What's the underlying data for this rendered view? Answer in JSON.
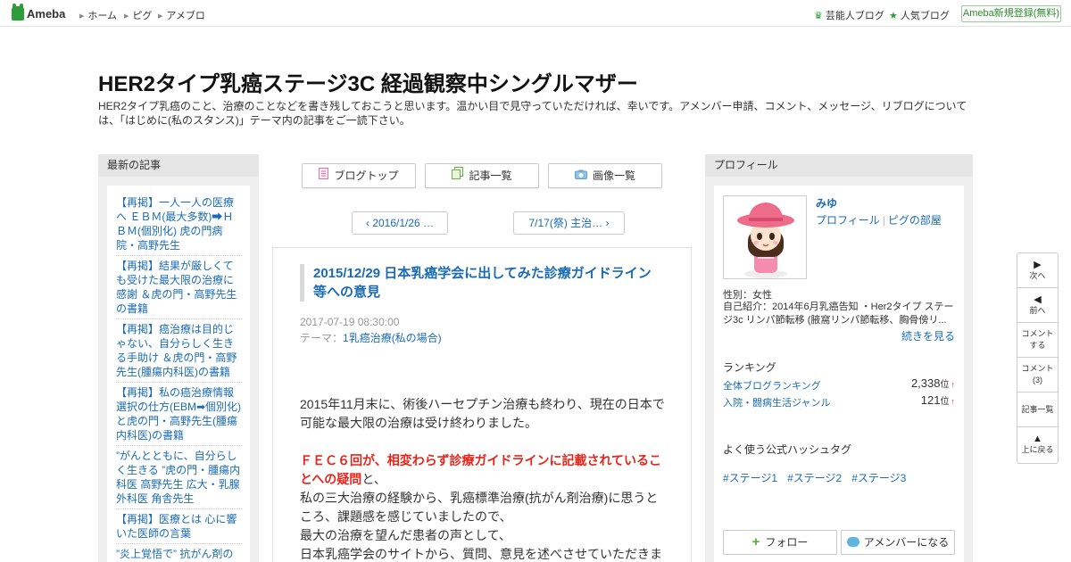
{
  "topbar": {
    "logo": "Ameba",
    "nav": [
      "ホーム",
      "ピグ",
      "アメブロ"
    ],
    "celeb_blog": "芸能人ブログ",
    "popular_blog": "人気ブログ",
    "signup": "Ameba新規登録(無料)"
  },
  "blog": {
    "title": "HER2タイプ乳癌ステージ3C 経過観察中シングルマザー",
    "description": "HER2タイプ乳癌のこと、治療のことなどを書き残しておこうと思います。温かい目で見守っていただければ、幸いです。アメンバー申請、コメント、メッセージ、リブログについては、「はじめに(私のスタンス)」テーマ内の記事をご一読下さい。"
  },
  "recent": {
    "heading": "最新の記事",
    "items": [
      "【再掲】一人一人の医療へ ＥＢＭ(最大多数)➡ＨＢＭ(個別化) 虎の門病院・高野先生",
      "【再掲】結果が厳しくても受けた最大限の治療に感謝 ＆虎の門・高野先生の書籍",
      "【再掲】癌治療は目的じゃない、自分らしく生きる手助け ＆虎の門・高野先生(腫瘍内科医)の書籍",
      "【再掲】私の癌治療情報選択の仕方(EBM➡個別化)と虎の門・高野先生(腫瘍内科医)の書籍",
      "”がんとともに、自分らしく生きる ”虎の門・腫瘍内科医 高野先生 広大・乳腺外科医 角舎先生",
      "【再掲】医療とは 心に響いた医師の言葉",
      "”炎上覚悟で” 抗がん剤の"
    ]
  },
  "toolbar": {
    "blog_top": "ブログトップ",
    "article_list": "記事一覧",
    "image_list": "画像一覧"
  },
  "pager": {
    "prev": "2016/1/26 …",
    "next": "7/17(祭) 主治…"
  },
  "article": {
    "title": "2015/12/29 日本乳癌学会に出してみた診療ガイドライン等への意見",
    "date": "2017-07-19 08:30:00",
    "theme_label": "テーマ：",
    "theme": "1乳癌治療(私の場合)",
    "para1": "2015年11月末に、術後ハーセプチン治療も終わり、現在の日本で可能な最大限の治療は受け終わりました。",
    "red_text": "ＦＥＣ６回が、相変わらず診療ガイドラインに記載されていることへの疑問",
    "red_suffix": "と、",
    "line1": "私の三大治療の経験から、乳癌標準治療(抗がん剤治療)に思うところ、課題感を感じていましたので、",
    "line2": "最大の治療を望んだ患者の声として、",
    "line3": "日本乳癌学会のサイトから、質問、意見を述べさせていただきま"
  },
  "profile": {
    "heading": "プロフィール",
    "name": "みゆ",
    "profile_link": "プロフィール",
    "pigg_link": "ピグの部屋",
    "gender": "性別：女性",
    "intro": "自己紹介：2014年6月乳癌告知 ・Her2タイプ ステージ3c リンパ節転移 (腋窩リンパ節転移、胸骨傍リ...",
    "more": "続きを見る",
    "ranking_heading": "ランキング",
    "rankings": [
      {
        "label": "全体ブログランキング",
        "value": "2,338",
        "unit": "位",
        "trend": "↑"
      },
      {
        "label": "入院・闘病生活ジャンル",
        "value": "121",
        "unit": "位",
        "trend": "↑"
      }
    ],
    "hashtag_heading": "よく使う公式ハッシュタグ",
    "hashtags": [
      "#ステージ1",
      "#ステージ2",
      "#ステージ3"
    ],
    "follow": "フォロー",
    "amember": "アメンバーになる"
  },
  "sidenav": {
    "next": "次へ",
    "prev": "前へ",
    "comment_write": [
      "コメント",
      "する"
    ],
    "comment_count": [
      "コメント",
      "(3)"
    ],
    "article_list": "記事一覧",
    "top": "上に戻る"
  }
}
